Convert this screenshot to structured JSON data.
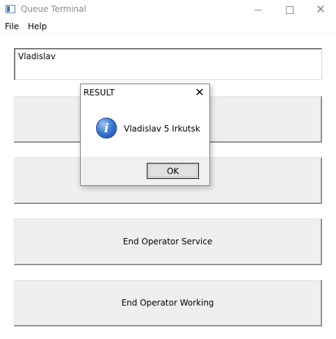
{
  "window": {
    "title": "Queue Terminal",
    "icon": "app-window-icon",
    "controls": {
      "minimize": "minimize-icon",
      "maximize": "maximize-icon",
      "close": "close-icon",
      "close_glyph": "✕"
    }
  },
  "menu": {
    "items": [
      {
        "label": "File"
      },
      {
        "label": "Help"
      }
    ]
  },
  "main": {
    "name_field": {
      "value": "Vladislav"
    },
    "buttons": [
      {
        "label": ""
      },
      {
        "label": ""
      },
      {
        "label": "End Operator Service"
      },
      {
        "label": "End Operator Working"
      }
    ]
  },
  "dialog": {
    "title": "RESULT",
    "close_glyph": "✕",
    "icon": "info-icon",
    "icon_glyph": "i",
    "message": "Vladislav 5 Irkutsk",
    "ok_label": "OK"
  },
  "colors": {
    "button_face": "#efefef",
    "dialog_footer": "#f0f0f0",
    "info_blue": "#3f7ad6"
  }
}
